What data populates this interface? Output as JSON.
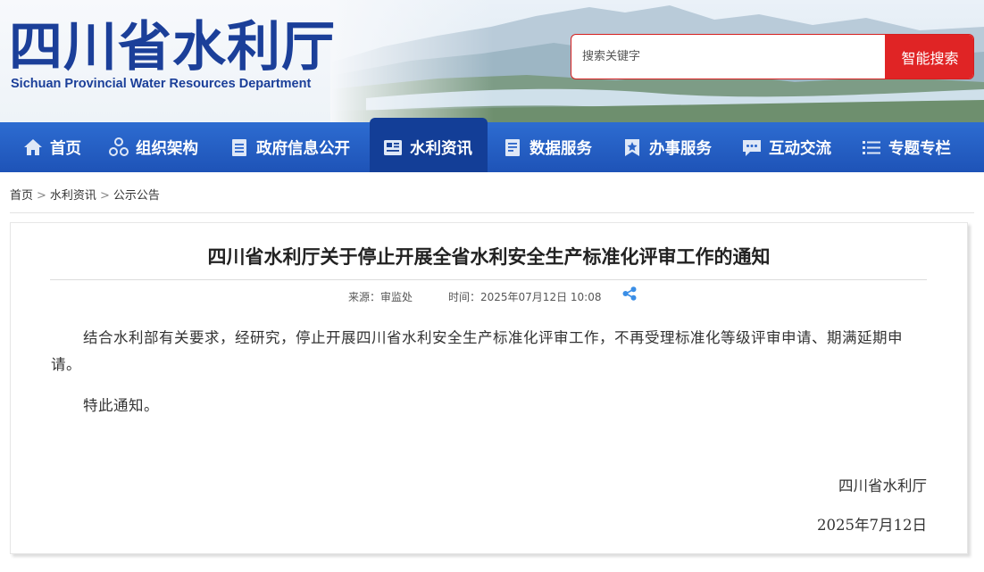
{
  "header": {
    "logo_cn": "四川省水利厅",
    "logo_en": "Sichuan Provincial Water Resources Department",
    "search": {
      "placeholder": "搜索关键字",
      "button_label": "智能搜索"
    }
  },
  "nav": {
    "items": [
      {
        "label": "首页",
        "icon": "home-icon"
      },
      {
        "label": "组织架构",
        "icon": "org-structure-icon"
      },
      {
        "label": "政府信息公开",
        "icon": "document-icon"
      },
      {
        "label": "水利资讯",
        "icon": "news-icon",
        "active": true
      },
      {
        "label": "数据服务",
        "icon": "data-icon"
      },
      {
        "label": "办事服务",
        "icon": "service-star-icon"
      },
      {
        "label": "互动交流",
        "icon": "chat-icon"
      },
      {
        "label": "专题专栏",
        "icon": "list-icon"
      }
    ]
  },
  "breadcrumb": {
    "items": [
      "首页",
      "水利资讯",
      "公示公告"
    ],
    "separator": ">"
  },
  "article": {
    "title": "四川省水利厅关于停止开展全省水利安全生产标准化评审工作的通知",
    "source": "来源：审监处",
    "time": "时间：2025年07月12日 10:08",
    "paragraphs": [
      "结合水利部有关要求，经研究，停止开展四川省水利安全生产标准化评审工作，不再受理标准化等级评审申请、期满延期申请。",
      "特此通知。"
    ],
    "signature": "四川省水利厅",
    "date": "2025年7月12日"
  },
  "colors": {
    "brand_blue": "#1b3f99",
    "nav_blue": "#2260c4",
    "nav_active": "#133e97",
    "search_red": "#e02425"
  }
}
